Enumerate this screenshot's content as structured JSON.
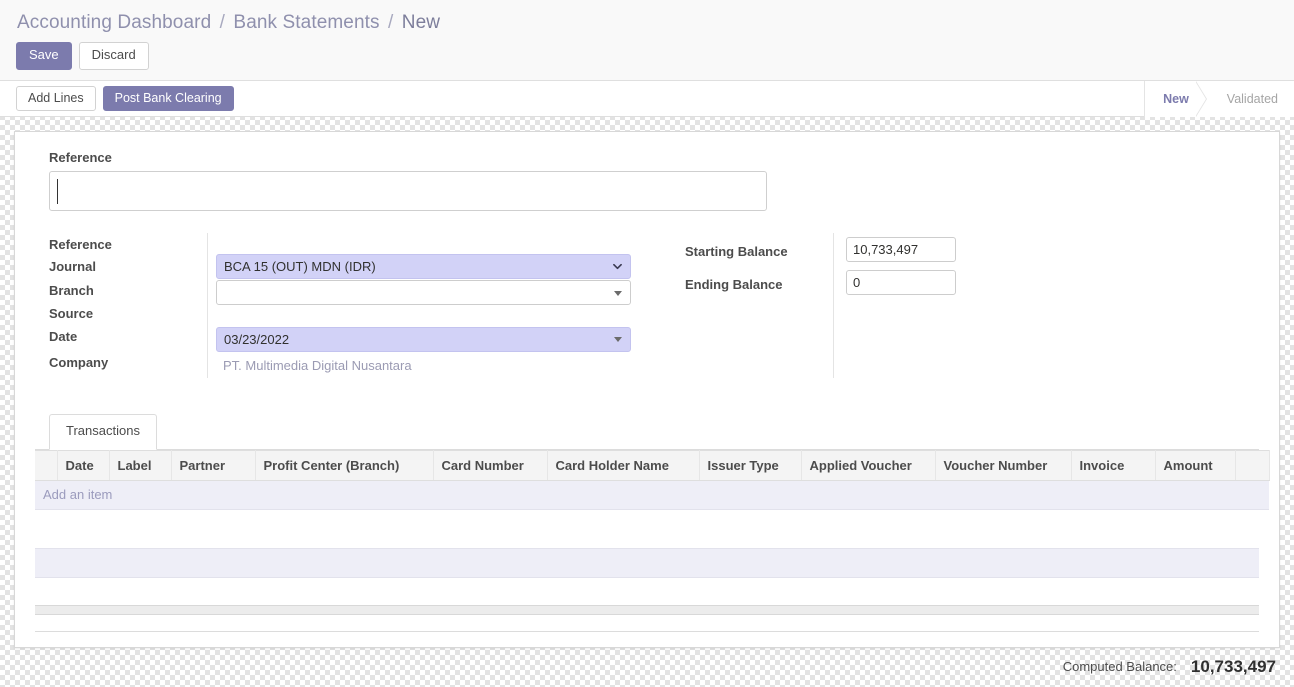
{
  "breadcrumb": {
    "items": [
      "Accounting Dashboard",
      "Bank Statements",
      "New"
    ],
    "separator": "/"
  },
  "actions": {
    "save_label": "Save",
    "discard_label": "Discard"
  },
  "toolbar": {
    "add_lines_label": "Add Lines",
    "post_bank_clearing_label": "Post Bank Clearing"
  },
  "statusbar": {
    "stages": [
      {
        "label": "New",
        "active": true
      },
      {
        "label": "Validated",
        "active": false
      }
    ]
  },
  "form": {
    "reference_title": "Reference",
    "reference_value": "",
    "reference_placeholder": "",
    "left_labels": [
      "Reference",
      "Journal",
      "Branch",
      "Source",
      "Date",
      "Company"
    ],
    "journal_label": "Journal",
    "journal_value": "BCA 15 (OUT) MDN (IDR)",
    "branch_label": "Branch",
    "branch_value": "",
    "date_label": "Date",
    "date_value": "03/23/2022",
    "company_label": "Company",
    "company_value": "PT. Multimedia Digital Nusantara",
    "starting_balance_label": "Starting Balance",
    "starting_balance_value": "10,733,497",
    "ending_balance_label": "Ending Balance",
    "ending_balance_value": "0"
  },
  "notebook": {
    "tabs": [
      {
        "label": "Transactions",
        "active": true
      }
    ]
  },
  "table": {
    "columns": [
      "Date",
      "Label",
      "Partner",
      "Profit Center (Branch)",
      "Card Number",
      "Card Holder Name",
      "Issuer Type",
      "Applied Voucher",
      "Voucher Number",
      "Invoice",
      "Amount"
    ],
    "rows": [],
    "add_item_label": "Add an item"
  },
  "footer": {
    "computed_balance_label": "Computed Balance:",
    "computed_balance_value": "10,733,497"
  },
  "colors": {
    "primary": "#7c7bad",
    "highlight_field": "#d2d2f7",
    "row_band": "#eeeef7",
    "breadcrumb": "#8f90ad",
    "muted_text": "#9b9bb3"
  }
}
